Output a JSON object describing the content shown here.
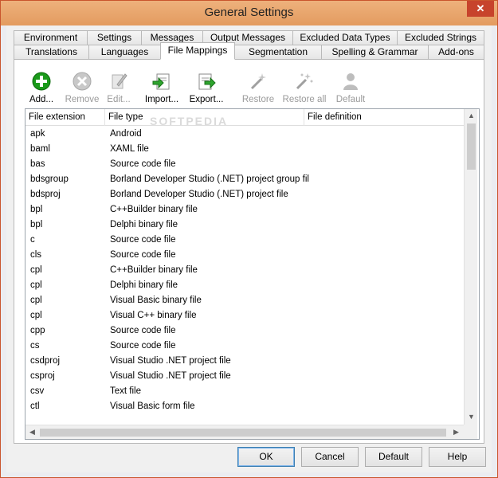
{
  "window": {
    "title": "General Settings",
    "close_glyph": "✕"
  },
  "tabs_row1": [
    "Environment",
    "Settings",
    "Messages",
    "Output Messages",
    "Excluded Data Types",
    "Excluded Strings"
  ],
  "tabs_row2": [
    "Translations",
    "Languages",
    "File Mappings",
    "Segmentation",
    "Spelling & Grammar",
    "Add-ons"
  ],
  "active_tab": "File Mappings",
  "toolbar": {
    "add": "Add...",
    "remove": "Remove",
    "edit": "Edit...",
    "import": "Import...",
    "export": "Export...",
    "restore": "Restore",
    "restore_all": "Restore all",
    "default": "Default"
  },
  "watermark": "SOFTPEDIA",
  "grid": {
    "columns": [
      "File extension",
      "File type",
      "File definition"
    ],
    "rows": [
      [
        "apk",
        "Android",
        ""
      ],
      [
        "baml",
        "XAML file",
        ""
      ],
      [
        "bas",
        "Source code file",
        ""
      ],
      [
        "bdsgroup",
        "Borland Developer Studio (.NET) project group file",
        ""
      ],
      [
        "bdsproj",
        "Borland Developer Studio (.NET) project file",
        ""
      ],
      [
        "bpl",
        "C++Builder binary file",
        ""
      ],
      [
        "bpl",
        "Delphi binary file",
        ""
      ],
      [
        "c",
        "Source code file",
        ""
      ],
      [
        "cls",
        "Source code file",
        ""
      ],
      [
        "cpl",
        "C++Builder binary file",
        ""
      ],
      [
        "cpl",
        "Delphi binary file",
        ""
      ],
      [
        "cpl",
        "Visual Basic binary file",
        ""
      ],
      [
        "cpl",
        "Visual C++ binary file",
        ""
      ],
      [
        "cpp",
        "Source code file",
        ""
      ],
      [
        "cs",
        "Source code file",
        ""
      ],
      [
        "csdproj",
        "Visual Studio .NET project file",
        ""
      ],
      [
        "csproj",
        "Visual Studio .NET project file",
        ""
      ],
      [
        "csv",
        "Text file",
        ""
      ],
      [
        "ctl",
        "Visual Basic form file",
        ""
      ]
    ]
  },
  "buttons": {
    "ok": "OK",
    "cancel": "Cancel",
    "default": "Default",
    "help": "Help"
  },
  "colors": {
    "title_bar": "#e8a76f",
    "close": "#c7432c",
    "add_icon": "#1a9a1a"
  }
}
